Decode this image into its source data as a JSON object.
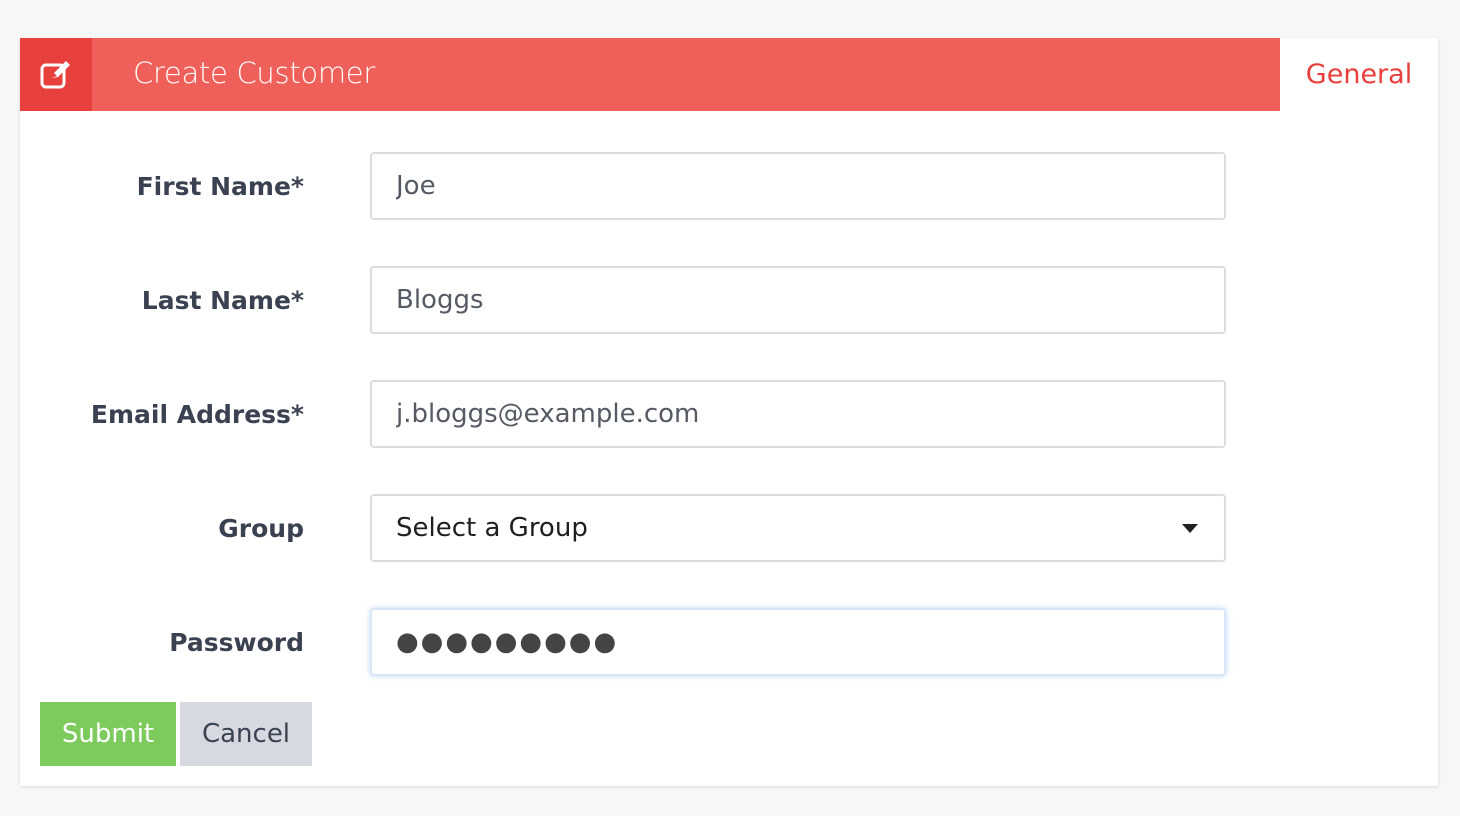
{
  "header": {
    "title": "Create Customer",
    "icon": "edit-icon",
    "accent_color": "#f0605b",
    "icon_box_color": "#e8403c"
  },
  "tabs": {
    "general": "General"
  },
  "form": {
    "first_name": {
      "label": "First Name*",
      "value": "Joe"
    },
    "last_name": {
      "label": "Last Name*",
      "value": "Bloggs"
    },
    "email": {
      "label": "Email Address*",
      "value": "j.bloggs@example.com"
    },
    "group": {
      "label": "Group",
      "value": "Select a Group"
    },
    "password": {
      "label": "Password",
      "value": "●●●●●●●●●"
    }
  },
  "buttons": {
    "submit": "Submit",
    "cancel": "Cancel",
    "submit_color": "#7ccb5c",
    "cancel_color": "#d6d9e0"
  }
}
